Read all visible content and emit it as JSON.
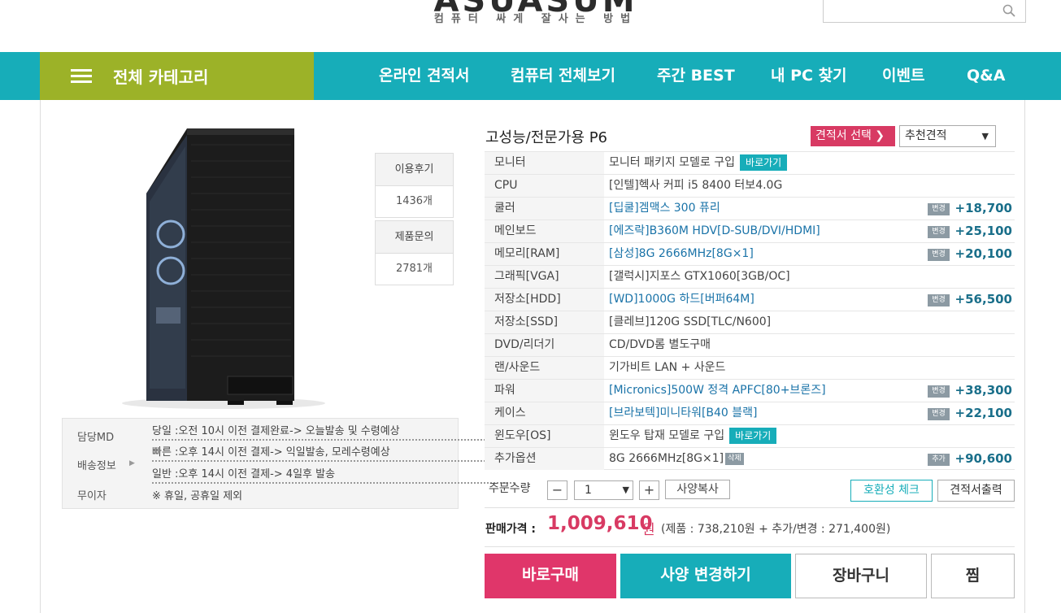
{
  "header": {
    "logo": "ASUASUM",
    "tagline": "컴퓨터 싸게 잘사는 방법",
    "search_placeholder": ""
  },
  "nav": {
    "category": "전체 카테고리",
    "items": [
      "온라인 견적서",
      "컴퓨터 전체보기",
      "주간 BEST",
      "내 PC 찾기",
      "이벤트",
      "Q&A"
    ]
  },
  "side": {
    "review_label": "이용후기",
    "review_count": "1436개",
    "qna_label": "제품문의",
    "qna_count": "2781개"
  },
  "shipping": {
    "md_label": "담당MD",
    "ship_label": "배송정보",
    "free_label": "무이자",
    "line1": "당일 :오전 10시 이전 결제완료-> 오늘발송 및 수령예상",
    "line2": "빠른 :오후 14시 이전 결제-> 익일발송, 모레수령예상",
    "line3": "일반 :오후 14시 이전 결제-> 4일후 발송",
    "line4": "※ 휴일, 공휴일 제외"
  },
  "product": {
    "title": "고성능/전문가용 P6",
    "quote_button": "견적서 선택 ❯",
    "quote_select": "추천견적"
  },
  "specs": [
    {
      "key": "모니터",
      "value": "모니터 패키지 모델로 구입",
      "goto": "바로가기"
    },
    {
      "key": "CPU",
      "value": "[인텔]헥사 커피 i5 8400 터보4.0G"
    },
    {
      "key": "쿨러",
      "value": "[딥쿨]겜맥스 300 퓨리",
      "badge": "변경",
      "price": "+18,700"
    },
    {
      "key": "메인보드",
      "value": "[에즈락]B360M HDV[D-SUB/DVI/HDMI]",
      "badge": "변경",
      "price": "+25,100"
    },
    {
      "key": "메모리[RAM]",
      "value": "[삼성]8G 2666MHz[8G×1]",
      "badge": "변경",
      "price": "+20,100"
    },
    {
      "key": "그래픽[VGA]",
      "value": "[갤럭시]지포스 GTX1060[3GB/OC]"
    },
    {
      "key": "저장소[HDD]",
      "value": "[WD]1000G 하드[버퍼64M]",
      "badge": "변경",
      "price": "+56,500"
    },
    {
      "key": "저장소[SSD]",
      "value": "[클레브]120G SSD[TLC/N600]"
    },
    {
      "key": "DVD/리더기",
      "value": "CD/DVD롬 별도구매"
    },
    {
      "key": "랜/사운드",
      "value": "기가비트 LAN + 사운드"
    },
    {
      "key": "파워",
      "value": "[Micronics]500W 정격 APFC[80+브론즈]",
      "badge": "변경",
      "price": "+38,300"
    },
    {
      "key": "케이스",
      "value": "[브라보텍]미니타워[B40 블랙]",
      "badge": "변경",
      "price": "+22,100"
    },
    {
      "key": "윈도우[OS]",
      "value": "윈도우 탑재 모델로 구입",
      "goto": "바로가기"
    },
    {
      "key": "추가옵션",
      "value": "8G 2666MHz[8G×1]",
      "del": "삭제",
      "badge": "추가",
      "price": "+90,600"
    }
  ],
  "order": {
    "qty_label": "주문수량",
    "minus": "−",
    "qty": "1",
    "plus": "+",
    "copy": "사양복사",
    "compat": "호환성 체크",
    "print": "견적서출력"
  },
  "price": {
    "label": "판매가격 :",
    "value": "1,009,610",
    "unit": "원",
    "detail": "(제품 : 738,210원 + 추가/변경 : 271,400원)"
  },
  "actions": {
    "buy": "바로구매",
    "change": "사양 변경하기",
    "cart": "장바구니",
    "wish": "찜"
  }
}
